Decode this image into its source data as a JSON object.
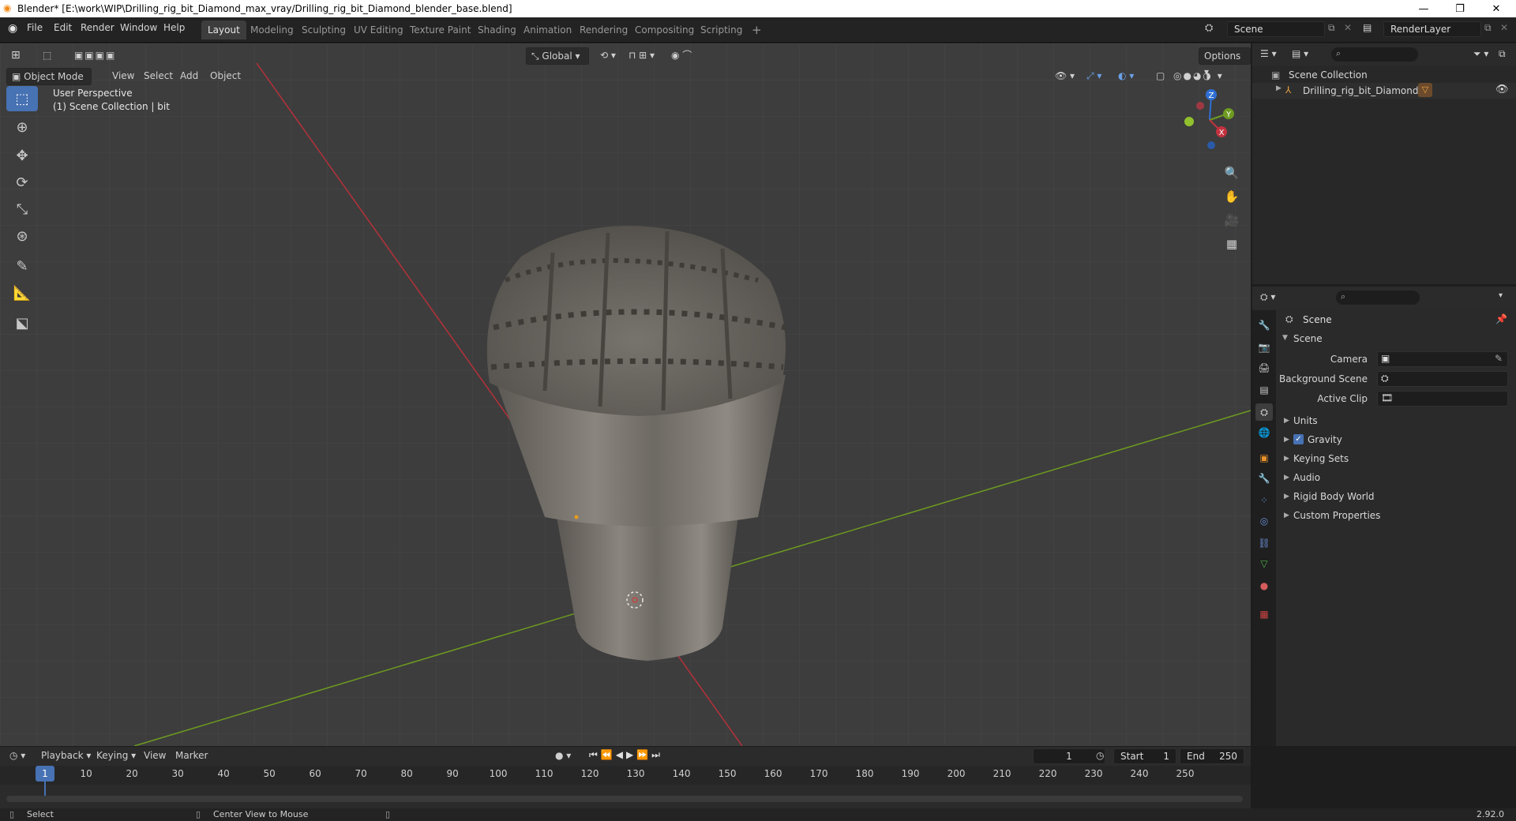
{
  "titlebar": {
    "title": "Blender* [E:\\work\\WIP\\Drilling_rig_bit_Diamond_max_vray/Drilling_rig_bit_Diamond_blender_base.blend]",
    "minimize": "—",
    "maximize": "❐",
    "close": "✕"
  },
  "menu": [
    "File",
    "Edit",
    "Render",
    "Window",
    "Help"
  ],
  "workspaces": [
    "Layout",
    "Modeling",
    "Sculpting",
    "UV Editing",
    "Texture Paint",
    "Shading",
    "Animation",
    "Rendering",
    "Compositing",
    "Scripting",
    "+"
  ],
  "scene_field": "Scene",
  "renderlayer_field": "RenderLayer",
  "viewport": {
    "mode": "Object Mode",
    "menus": [
      "View",
      "Select",
      "Add",
      "Object"
    ],
    "transform_orientation": "Global",
    "options": "Options",
    "overlay_line1": "User Perspective",
    "overlay_line2": "(1) Scene Collection | bit",
    "gizmo": {
      "x": "X",
      "y": "Y",
      "z": "Z"
    }
  },
  "outliner": {
    "root": "Scene Collection",
    "item": "Drilling_rig_bit_Diamond"
  },
  "properties": {
    "context": "Scene",
    "panel": "Scene",
    "rows": [
      {
        "label": "Camera"
      },
      {
        "label": "Background Scene"
      },
      {
        "label": "Active Clip"
      }
    ],
    "subpanels": [
      "Units",
      "Gravity",
      "Keying Sets",
      "Audio",
      "Rigid Body World",
      "Custom Properties"
    ]
  },
  "timeline": {
    "menus": [
      "Playback",
      "Keying",
      "View",
      "Marker"
    ],
    "current_frame": "1",
    "start_label": "Start",
    "start": "1",
    "end_label": "End",
    "end": "250",
    "ticks": [
      "1",
      "10",
      "20",
      "30",
      "40",
      "50",
      "60",
      "70",
      "80",
      "90",
      "100",
      "110",
      "120",
      "130",
      "140",
      "150",
      "160",
      "170",
      "180",
      "190",
      "200",
      "210",
      "220",
      "230",
      "240",
      "250"
    ]
  },
  "status": {
    "left": "Select",
    "middle": "Center View to Mouse",
    "version": "2.92.0"
  },
  "colors": {
    "accent": "#4772b3",
    "x_axis": "#c2323e",
    "y_axis": "#6d9b20",
    "z_axis": "#2f6fd4"
  }
}
